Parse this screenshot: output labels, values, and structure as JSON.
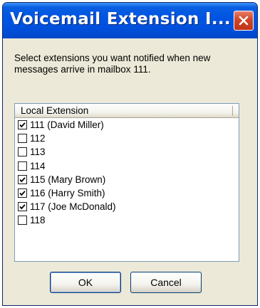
{
  "window": {
    "title": "Voicemail Extension I...",
    "close_label": "X"
  },
  "instructions": "Select extensions you want notified when new messages arrive in mailbox 111.",
  "list": {
    "column_header": "Local Extension",
    "items": [
      {
        "label": "111 (David Miller)",
        "checked": true
      },
      {
        "label": "112",
        "checked": false
      },
      {
        "label": "113",
        "checked": false
      },
      {
        "label": "114",
        "checked": false
      },
      {
        "label": "115 (Mary Brown)",
        "checked": true
      },
      {
        "label": "116 (Harry Smith)",
        "checked": true
      },
      {
        "label": "117 (Joe McDonald)",
        "checked": true
      },
      {
        "label": "118",
        "checked": false
      }
    ]
  },
  "buttons": {
    "ok_label": "OK",
    "cancel_label": "Cancel"
  },
  "colors": {
    "titlebar": "#0054e3",
    "dialog_bg": "#ece9d8",
    "close_button": "#d04628"
  }
}
